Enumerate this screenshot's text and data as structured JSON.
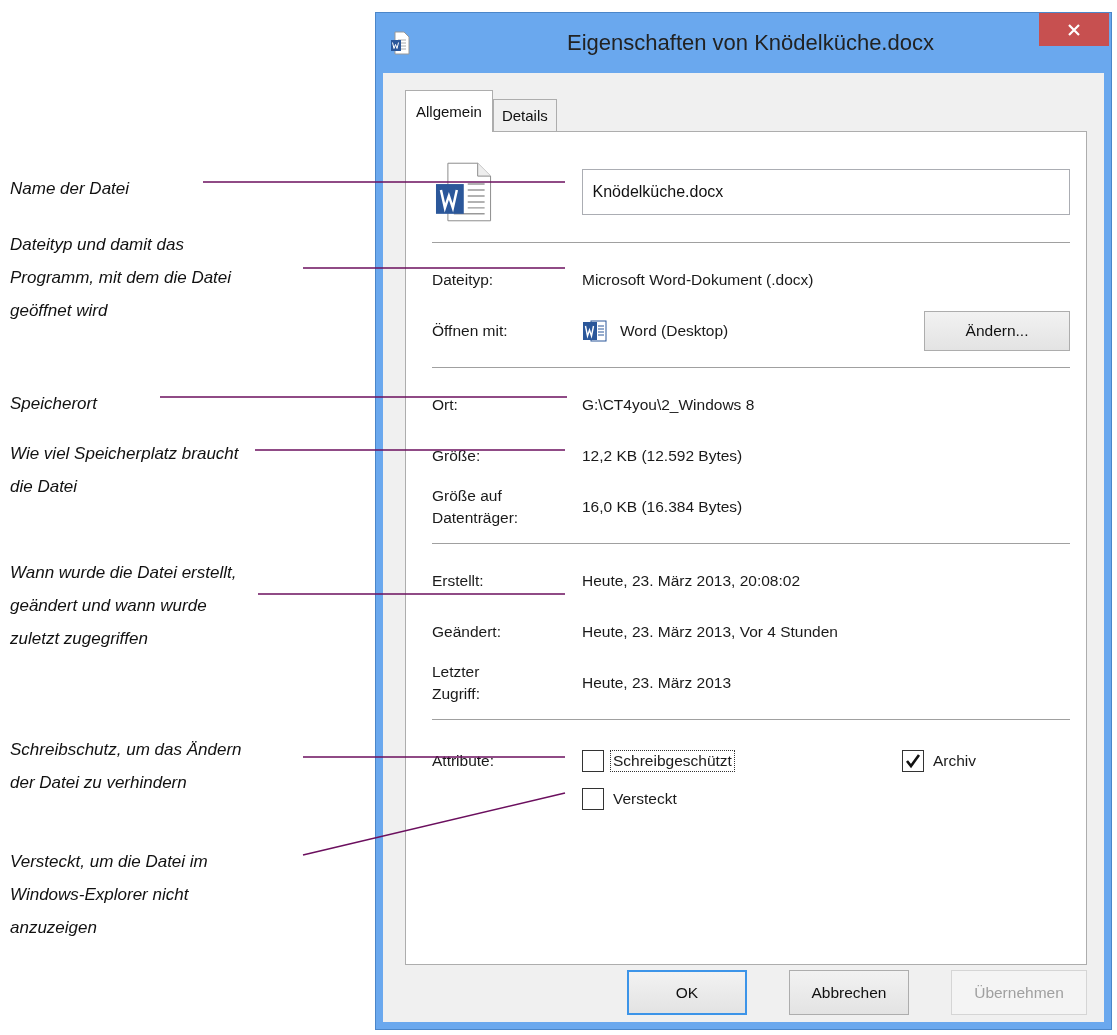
{
  "annotations": [
    {
      "text": "Name der Datei"
    },
    {
      "text": "Dateityp und damit das Programm, mit dem die Datei geöffnet wird"
    },
    {
      "text": "Speicherort"
    },
    {
      "text": "Wie viel Speicherplatz braucht die Datei"
    },
    {
      "text": "Wann wurde die Datei erstellt, geändert und wann wurde zuletzt zugegriffen"
    },
    {
      "text": "Schreibschutz, um das Ändern der Datei zu verhindern"
    },
    {
      "text": "Versteckt, um die Datei im Windows-Explorer nicht anzuzeigen"
    }
  ],
  "window": {
    "title": "Eigenschaften von Knödelküche.docx"
  },
  "tabs": [
    {
      "label": "Allgemein",
      "selected": true
    },
    {
      "label": "Details",
      "selected": false
    }
  ],
  "file_name": {
    "value": "Knödelküche.docx"
  },
  "sections": [
    [
      {
        "kind": "text",
        "label": "Dateityp:",
        "value": "Microsoft Word-Dokument (.docx)"
      },
      {
        "kind": "app",
        "label": "Öffnen mit:",
        "value": "Word (Desktop)",
        "button": "Ändern..."
      }
    ],
    [
      {
        "kind": "text",
        "label": "Ort:",
        "value": "G:\\CT4you\\2_Windows 8"
      },
      {
        "kind": "text",
        "label": "Größe:",
        "value": "12,2 KB (12.592 Bytes)"
      },
      {
        "kind": "text",
        "label": "Größe auf\nDatenträger:",
        "value": "16,0 KB (16.384 Bytes)"
      }
    ],
    [
      {
        "kind": "text",
        "label": "Erstellt:",
        "value": "Heute, 23. März 2013, 20:08:02"
      },
      {
        "kind": "text",
        "label": "Geändert:",
        "value": "Heute, 23. März 2013, Vor 4 Stunden"
      },
      {
        "kind": "text",
        "label": "Letzter\nZugriff:",
        "value": "Heute, 23. März 2013"
      }
    ]
  ],
  "attributes": {
    "label": "Attribute:",
    "options": [
      {
        "label": "Schreibgeschützt",
        "checked": false,
        "focused": true
      },
      {
        "label": "Archiv",
        "checked": true,
        "focused": false
      },
      {
        "label": "Versteckt",
        "checked": false,
        "focused": false
      }
    ]
  },
  "buttons": [
    {
      "label": "OK",
      "default": true,
      "disabled": false
    },
    {
      "label": "Abbrechen",
      "default": false,
      "disabled": false
    },
    {
      "label": "Übernehmen",
      "default": false,
      "disabled": true
    }
  ]
}
